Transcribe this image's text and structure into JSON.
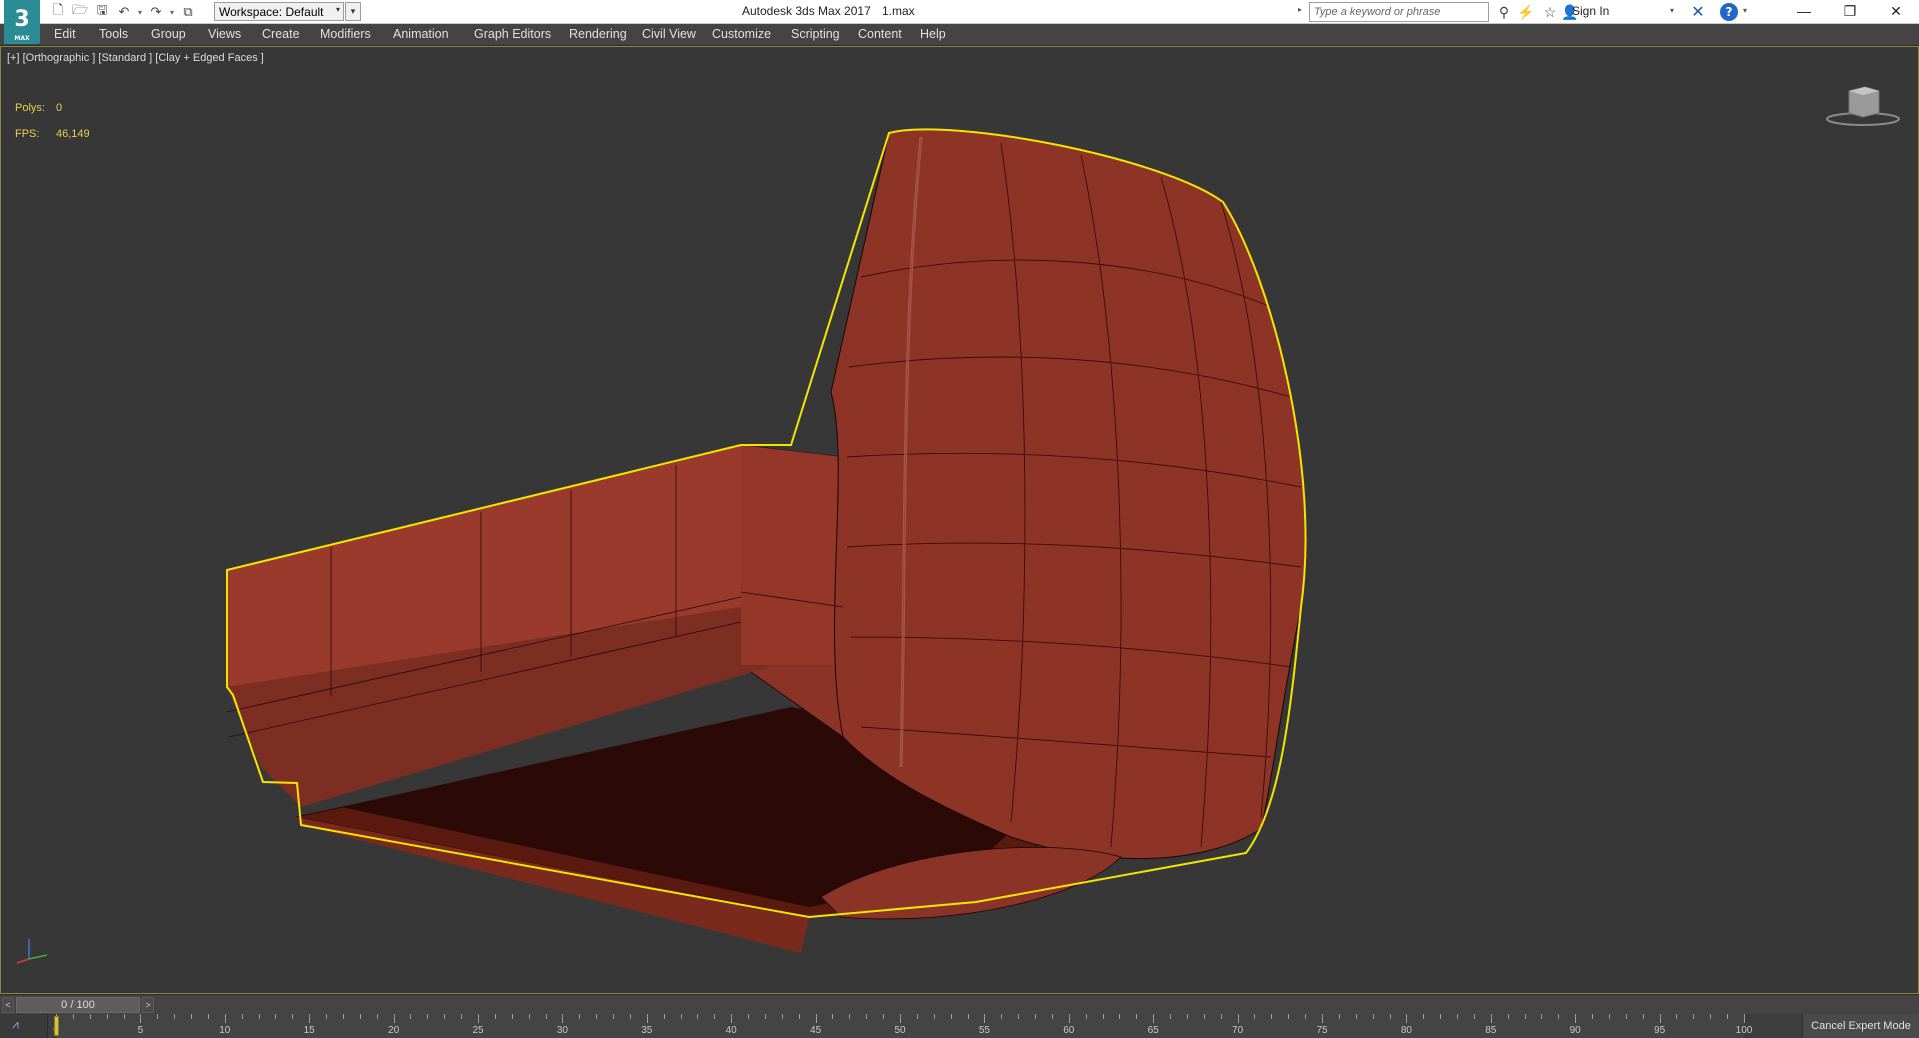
{
  "titlebar": {
    "app_logo": "3",
    "app_logo_sub": "MAX",
    "workspace_label": "Workspace: Default",
    "app_title": "Autodesk 3ds Max 2017",
    "file_name": "1.max",
    "search_placeholder": "Type a keyword or phrase",
    "sign_in": "Sign In"
  },
  "menu": {
    "items": [
      "Edit",
      "Tools",
      "Group",
      "Views",
      "Create",
      "Modifiers",
      "Animation",
      "Graph Editors",
      "Rendering",
      "Civil View",
      "Customize",
      "Scripting",
      "Content",
      "Help"
    ]
  },
  "viewport": {
    "label": "[+] [Orthographic ] [Standard ] [Clay + Edged Faces ]",
    "stats": {
      "polys_label": "Polys:",
      "polys_value": "0",
      "fps_label": "FPS:",
      "fps_value": "46,149"
    },
    "model_color": "#8a3326",
    "selection_color": "#f2e600"
  },
  "timeline": {
    "slider_value": "0 / 100",
    "prev": "<",
    "next": ">",
    "ticks": [
      "0",
      "5",
      "10",
      "15",
      "20",
      "25",
      "30",
      "35",
      "40",
      "45",
      "50",
      "55",
      "60",
      "65",
      "70",
      "75",
      "80",
      "85",
      "90",
      "95",
      "100"
    ],
    "cancel_expert": "Cancel Expert Mode"
  },
  "icons": [
    "new-icon",
    "open-icon",
    "save-icon",
    "undo-icon",
    "redo-icon",
    "project-icon",
    "binoculars-icon",
    "star-icon",
    "user-icon",
    "exchange-icon",
    "help-icon",
    "minimize-icon",
    "restore-icon",
    "close-icon",
    "viewcube-icon",
    "axis-tripod-icon",
    "curve-editor-icon"
  ]
}
